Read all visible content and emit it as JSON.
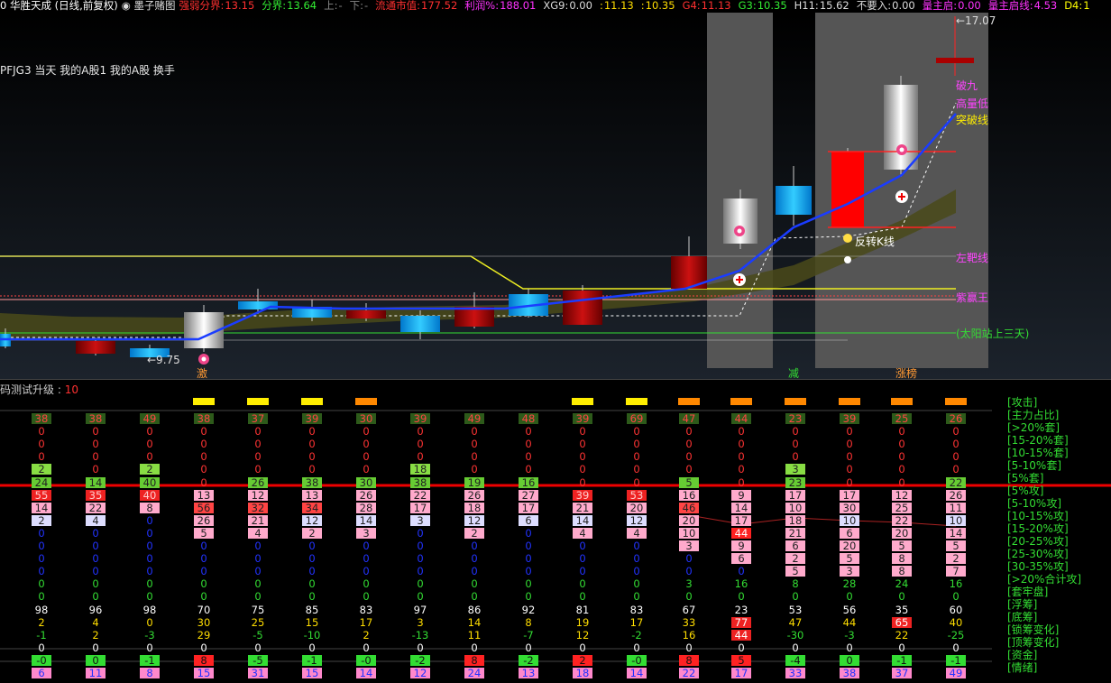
{
  "header": {
    "stock": "0 华胜天成 (日线,前复权)",
    "indicator_name": "墨子赌图",
    "items": [
      {
        "label": "强弱分界:",
        "value": "13.15",
        "color": "#ff3030"
      },
      {
        "label": "分界:",
        "value": "13.64",
        "color": "#33ee33"
      },
      {
        "label": "上:",
        "value": "-",
        "color": "#888888"
      },
      {
        "label": "下:",
        "value": "-",
        "color": "#888888"
      },
      {
        "label": "流通市值:",
        "value": "177.52",
        "color": "#ff3030"
      },
      {
        "label": "利润%:",
        "value": "188.01",
        "color": "#ff33ff"
      },
      {
        "label": "XG9:",
        "value": "0.00",
        "color": "#dddddd"
      },
      {
        "label": ":",
        "value": "11.13",
        "color": "#ffdd00"
      },
      {
        "label": ":",
        "value": "10.35",
        "color": "#ffdd00"
      },
      {
        "label": "G4:",
        "value": "11.13",
        "color": "#ff3030"
      },
      {
        "label": "G3:",
        "value": "10.35",
        "color": "#33ee33"
      },
      {
        "label": "H11:",
        "value": "15.62",
        "color": "#dddddd"
      },
      {
        "label": "不要入:",
        "value": "0.00",
        "color": "#dddddd"
      },
      {
        "label": "量主启:",
        "value": "0.00",
        "color": "#ff33ff"
      },
      {
        "label": "量主启线:",
        "value": "4.53",
        "color": "#ff33ff"
      },
      {
        "label": "D4:",
        "value": "1",
        "color": "#ffff00"
      }
    ]
  },
  "indicators_line": "PFJG3  当天  我的A股1  我的A股  换手",
  "main_labels": {
    "high": "←17.07",
    "low": "←9.75",
    "l_jiujiu": "破九",
    "l_gaoliang": "高量低",
    "l_tupo": "突破线",
    "l_fanzhuan": "反转K线",
    "l_zuomai": "左靶线",
    "l_ziying": "紫赢王",
    "l_taiyang": "(太阳站上三天)",
    "marker_ji": "激",
    "marker_jian": "减",
    "marker_zhangting": "涨榜"
  },
  "sub": {
    "title": "码测试升级",
    "title_value": "10",
    "signals": [
      "",
      "",
      "",
      "#ffee00",
      "#ffee00",
      "#ffee00",
      "#ff8800",
      "",
      "",
      "",
      "#ffee00",
      "#ffee00",
      "#ff8800",
      "#ff8800",
      "#ff8800",
      "#ff8800",
      "#ff8800",
      "#ff8800"
    ],
    "row_labels": [
      "[攻击]",
      "[主力占比]",
      "[>20%套]",
      "[15-20%套]",
      "[10-15%套]",
      "[5-10%套]",
      "[5%套]",
      "[5%攻]",
      "[5-10%攻]",
      "[10-15%攻]",
      "[15-20%攻]",
      "[20-25%攻]",
      "[25-30%攻]",
      "[30-35%攻]",
      "[>20%合计攻]",
      "[套牢盘]",
      "[浮筹]",
      "[底筹]",
      "[锁筹变化]",
      "[顶筹变化]",
      "[资金]",
      "[情绪]"
    ],
    "rows": [
      [
        "38",
        "38",
        "49",
        "38",
        "37",
        "39",
        "30",
        "39",
        "49",
        "48",
        "39",
        "69",
        "47",
        "44",
        "23",
        "39",
        "25",
        "26"
      ],
      [
        "0",
        "0",
        "0",
        "0",
        "0",
        "0",
        "0",
        "0",
        "0",
        "0",
        "0",
        "0",
        "0",
        "0",
        "0",
        "0",
        "0",
        "0"
      ],
      [
        "0",
        "0",
        "0",
        "0",
        "0",
        "0",
        "0",
        "0",
        "0",
        "0",
        "0",
        "0",
        "0",
        "0",
        "0",
        "0",
        "0",
        "0"
      ],
      [
        "0",
        "0",
        "0",
        "0",
        "0",
        "0",
        "0",
        "0",
        "0",
        "0",
        "0",
        "0",
        "0",
        "0",
        "0",
        "0",
        "0",
        "0"
      ],
      [
        "2",
        "0",
        "2",
        "0",
        "0",
        "0",
        "0",
        "18",
        "0",
        "0",
        "0",
        "0",
        "0",
        "0",
        "3",
        "0",
        "0",
        "0"
      ],
      [
        "24",
        "14",
        "40",
        "0",
        "26",
        "38",
        "30",
        "38",
        "19",
        "16",
        "0",
        "0",
        "5",
        "0",
        "23",
        "0",
        "0",
        "22"
      ],
      [
        "55",
        "35",
        "40",
        "13",
        "12",
        "13",
        "26",
        "22",
        "26",
        "27",
        "39",
        "53",
        "16",
        "9",
        "17",
        "17",
        "12",
        "26"
      ],
      [
        "14",
        "22",
        "8",
        "56",
        "32",
        "34",
        "28",
        "17",
        "18",
        "17",
        "21",
        "20",
        "46",
        "14",
        "10",
        "30",
        "25",
        "11"
      ],
      [
        "2",
        "4",
        "0",
        "26",
        "21",
        "12",
        "14",
        "3",
        "12",
        "6",
        "14",
        "12",
        "20",
        "17",
        "18",
        "10",
        "22",
        "10"
      ],
      [
        "0",
        "0",
        "0",
        "5",
        "4",
        "2",
        "3",
        "0",
        "2",
        "0",
        "4",
        "4",
        "10",
        "44",
        "21",
        "6",
        "20",
        "14"
      ],
      [
        "0",
        "0",
        "0",
        "0",
        "0",
        "0",
        "0",
        "0",
        "0",
        "0",
        "0",
        "0",
        "3",
        "9",
        "6",
        "20",
        "5",
        "5"
      ],
      [
        "0",
        "0",
        "0",
        "0",
        "0",
        "0",
        "0",
        "0",
        "0",
        "0",
        "0",
        "0",
        "0",
        "6",
        "2",
        "5",
        "8",
        "2"
      ],
      [
        "0",
        "0",
        "0",
        "0",
        "0",
        "0",
        "0",
        "0",
        "0",
        "0",
        "0",
        "0",
        "0",
        "0",
        "5",
        "3",
        "8",
        "7"
      ],
      [
        "0",
        "0",
        "0",
        "0",
        "0",
        "0",
        "0",
        "0",
        "0",
        "0",
        "0",
        "0",
        "3",
        "16",
        "8",
        "28",
        "24",
        "16"
      ],
      [
        "0",
        "0",
        "0",
        "0",
        "0",
        "0",
        "0",
        "0",
        "0",
        "0",
        "0",
        "0",
        "0",
        "0",
        "0",
        "0",
        "0",
        "0"
      ],
      [
        "98",
        "96",
        "98",
        "70",
        "75",
        "85",
        "83",
        "97",
        "86",
        "92",
        "81",
        "83",
        "67",
        "23",
        "53",
        "56",
        "35",
        "60"
      ],
      [
        "2",
        "4",
        "0",
        "30",
        "25",
        "15",
        "17",
        "3",
        "14",
        "8",
        "19",
        "17",
        "33",
        "77",
        "47",
        "44",
        "65",
        "40"
      ],
      [
        "-1",
        "2",
        "-3",
        "29",
        "-5",
        "-10",
        "2",
        "-13",
        "11",
        "-7",
        "12",
        "-2",
        "16",
        "44",
        "-30",
        "-3",
        "22",
        "-25"
      ],
      [
        "0",
        "0",
        "0",
        "0",
        "0",
        "0",
        "0",
        "0",
        "0",
        "0",
        "0",
        "0",
        "0",
        "0",
        "0",
        "0",
        "0",
        "0"
      ],
      [
        "-0",
        "0",
        "-1",
        "8",
        "-5",
        "-1",
        "-0",
        "-2",
        "8",
        "-2",
        "2",
        "-0",
        "8",
        "5",
        "-4",
        "0",
        "-1",
        "-1"
      ],
      [
        "6",
        "11",
        "8",
        "15",
        "31",
        "15",
        "14",
        "12",
        "24",
        "13",
        "18",
        "14",
        "22",
        "17",
        "33",
        "38",
        "37",
        "49"
      ]
    ]
  }
}
